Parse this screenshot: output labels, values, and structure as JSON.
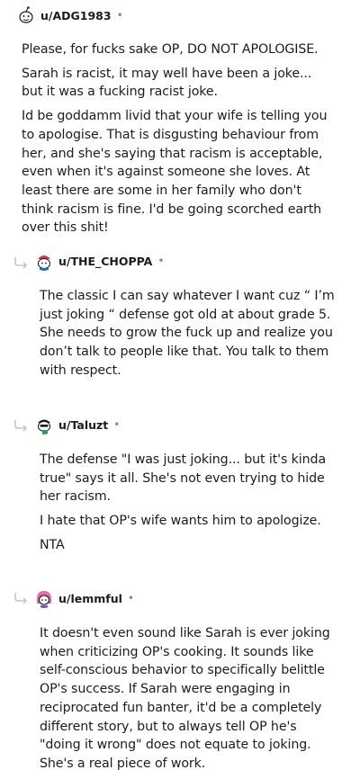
{
  "comments": [
    {
      "username": "u/ADG1983",
      "dot": "•",
      "paragraphs": [
        "Please, for fucks sake OP, DO NOT APOLOGISE.",
        "Sarah is racist, it may well have been a joke... but it was a fucking racist joke.",
        "Id be goddamm livid that your wife is telling you to apologise. That is disgusting behaviour from her, and she's saying that racism is acceptable, even when it's against someone she loves. At least there are some in her family who don't think racism is fine. I'd be going scorched earth over this shit!"
      ]
    },
    {
      "username": "u/THE_CHOPPA",
      "dot": "•",
      "paragraphs": [
        "The classic I can say whatever I want cuz “ I’m just joking “ defense got old at about grade 5. She needs to grow the fuck up and realize you don’t talk to people like that. You talk to them with respect."
      ]
    },
    {
      "username": "u/Taluzt",
      "dot": "•",
      "paragraphs": [
        "The defense \"I was just joking... but it's kinda true\" says it all. She's not even trying to hide her racism.",
        "I hate that OP's wife wants him to apologize.",
        "NTA"
      ]
    },
    {
      "username": "u/lemmful",
      "dot": "•",
      "paragraphs": [
        "It doesn't even sound like Sarah is ever joking when criticizing OP's cooking. It sounds like self-conscious behavior to specifically belittle OP's success. If Sarah were engaging in reciprocated fun banter, it'd be a completely different story, but to always tell OP he's \"doing it wrong\" does not equate to joking. She's a real piece of work."
      ]
    }
  ]
}
